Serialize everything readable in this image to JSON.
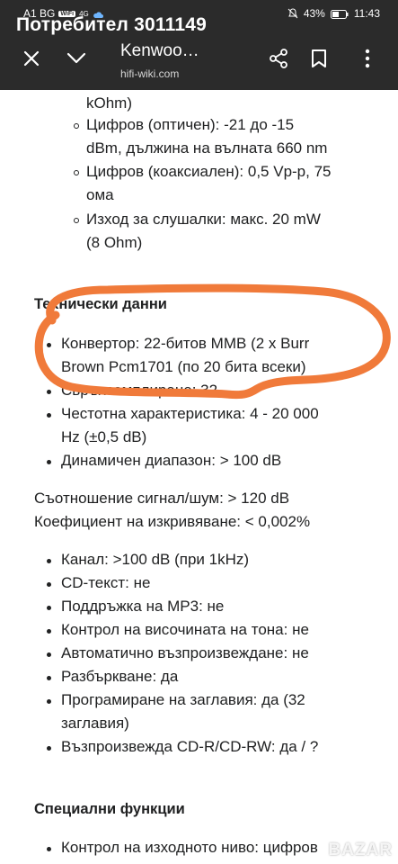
{
  "status_bar": {
    "carrier": "A1 BG",
    "wifi_label": "WiFi",
    "network": "4G",
    "battery": "43%",
    "time": "11:43"
  },
  "notification_overlay": "Потребител 3011149",
  "toolbar": {
    "title": "Kenwoo…",
    "url": "hifi-wiki.com"
  },
  "outputs": {
    "partial_top": "kOhm)",
    "items": [
      {
        "line1": "Цифров (оптичен): -21 до -15",
        "line2": "dBm, дължина на вълната 660 nm"
      },
      {
        "line1": "Цифров (коаксиален): 0,5 Vp-p, 75",
        "line2": "ома"
      },
      {
        "line1": "Изход за слушалки: макс. 20 mW",
        "line2": "(8 Ohm)"
      }
    ]
  },
  "technical": {
    "heading": "Технически данни",
    "items": [
      {
        "line1": "Конвертор: 22-битов MMB (2 x Burr",
        "line2": "Brown Pcm1701 (по 20 бита всеки)"
      },
      {
        "line1": "Свръхсемплиране: 32",
        "line2": ""
      },
      {
        "line1": "Честотна характеристика: 4 - 20 000",
        "line2": "Hz (±0,5 dB)"
      },
      {
        "line1": "Динамичен диапазон: > 100 dB",
        "line2": ""
      }
    ],
    "snr": "Съотношение сигнал/шум: > 120 dB",
    "distortion": "Коефициент на изкривяване: < 0,002%"
  },
  "features": {
    "items": [
      {
        "line1": "Канал: >100 dB (при 1kHz)",
        "line2": ""
      },
      {
        "line1": "CD-текст: не",
        "line2": ""
      },
      {
        "line1": "Поддръжка на MP3: не",
        "line2": ""
      },
      {
        "line1": "Контрол на височината на тона: не",
        "line2": ""
      },
      {
        "line1": "Автоматично възпроизвеждане: не",
        "line2": ""
      },
      {
        "line1": "Разбъркване: да",
        "line2": ""
      },
      {
        "line1": "Програмиране на заглавия: да (32",
        "line2": "заглавия)"
      },
      {
        "line1": "Възпроизвежда CD-R/CD-RW: да / ?",
        "line2": ""
      }
    ]
  },
  "special": {
    "heading": "Специални функции",
    "items": [
      {
        "line1": "Контрол на изходното ниво: цифров"
      }
    ]
  },
  "watermark": "BAZAR",
  "colors": {
    "header_bg": "#2b2b2b",
    "annotation_orange": "#f07a3a",
    "text": "#202122"
  }
}
